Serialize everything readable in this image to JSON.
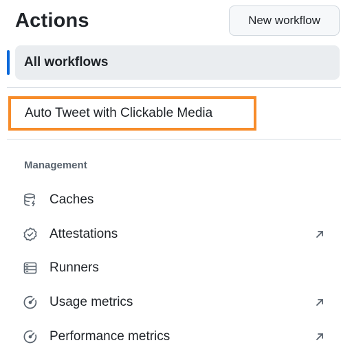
{
  "header": {
    "title": "Actions",
    "new_workflow_label": "New workflow"
  },
  "nav": {
    "all_workflows_label": "All workflows",
    "workflows": [
      {
        "label": "Auto Tweet with Clickable Media",
        "highlighted": true
      }
    ]
  },
  "management": {
    "section_label": "Management",
    "items": [
      {
        "label": "Caches",
        "icon": "cache-icon",
        "external": false
      },
      {
        "label": "Attestations",
        "icon": "verified-icon",
        "external": true
      },
      {
        "label": "Runners",
        "icon": "server-icon",
        "external": false
      },
      {
        "label": "Usage metrics",
        "icon": "meter-icon",
        "external": true
      },
      {
        "label": "Performance metrics",
        "icon": "meter-icon",
        "external": true
      }
    ]
  },
  "colors": {
    "accent": "#0969da",
    "highlight_border": "#f78c2a",
    "selected_bg": "#eaedf0"
  }
}
